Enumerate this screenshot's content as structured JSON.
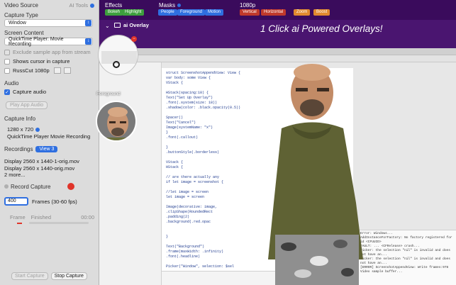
{
  "sidebar": {
    "video_source_label": "Video Source",
    "ai_tools_label": "AI Tools",
    "capture_type_label": "Capture Type",
    "capture_type_value": "Window",
    "screen_content_label": "Screen Content",
    "screen_content_value": "QuickTime Player: Movie Recording",
    "exclude_sample_label": "Exclude sample app from stream",
    "shows_cursor_label": "Shows cursor in capture",
    "russcut_label": "RussCut 1080p",
    "audio_label": "Audio",
    "capture_audio_label": "Capture audio",
    "play_app_audio_label": "Play App Audio",
    "capture_info_label": "Capture Info",
    "capture_size": "1280 x 720",
    "capture_source": "QuickTime Player Movie Recording",
    "recordings_label": "Recordings",
    "view_button_label": "View 3",
    "recordings": [
      "Display 2560 x 1440-1-orig.mov",
      "Display 2560 x 1440-orig.mov"
    ],
    "more_label": "2 more...",
    "record_capture_label": "Record Capture",
    "frames_value": "400",
    "frames_label": "Frames (30-60 fps)",
    "frame_col": "Frame",
    "finished_col": "Finished",
    "time_value": "00:00",
    "start_capture_label": "Start Capture",
    "stop_capture_label": "Stop Capture"
  },
  "topbar": {
    "effects_label": "Effects",
    "masks_label": "Masks",
    "resolution_label": "1080p",
    "effects_tags": [
      "Bokeh",
      "Highlight"
    ],
    "masks_tags": [
      "People",
      "Foreground",
      "Motion"
    ],
    "resolution_tags": [
      "Vertical",
      "Horizontal"
    ],
    "extra_tags": [
      "Zoom",
      "Boost"
    ]
  },
  "banner": {
    "overlay_label": "ai Overlay",
    "headline": "1 Click ai Powered Overlays!"
  },
  "overlay": {
    "foreground_label": "Foreground"
  },
  "colors": {
    "accent": "#2f6fe0",
    "topbar_bg": "#3a0b5c",
    "banner_bg": "#4a1570",
    "tag_green": "#3d9e3d",
    "tag_blue": "#2f6fe0",
    "tag_red": "#c0392b",
    "tag_orange": "#e08a2f",
    "record_red": "#e0342a"
  }
}
